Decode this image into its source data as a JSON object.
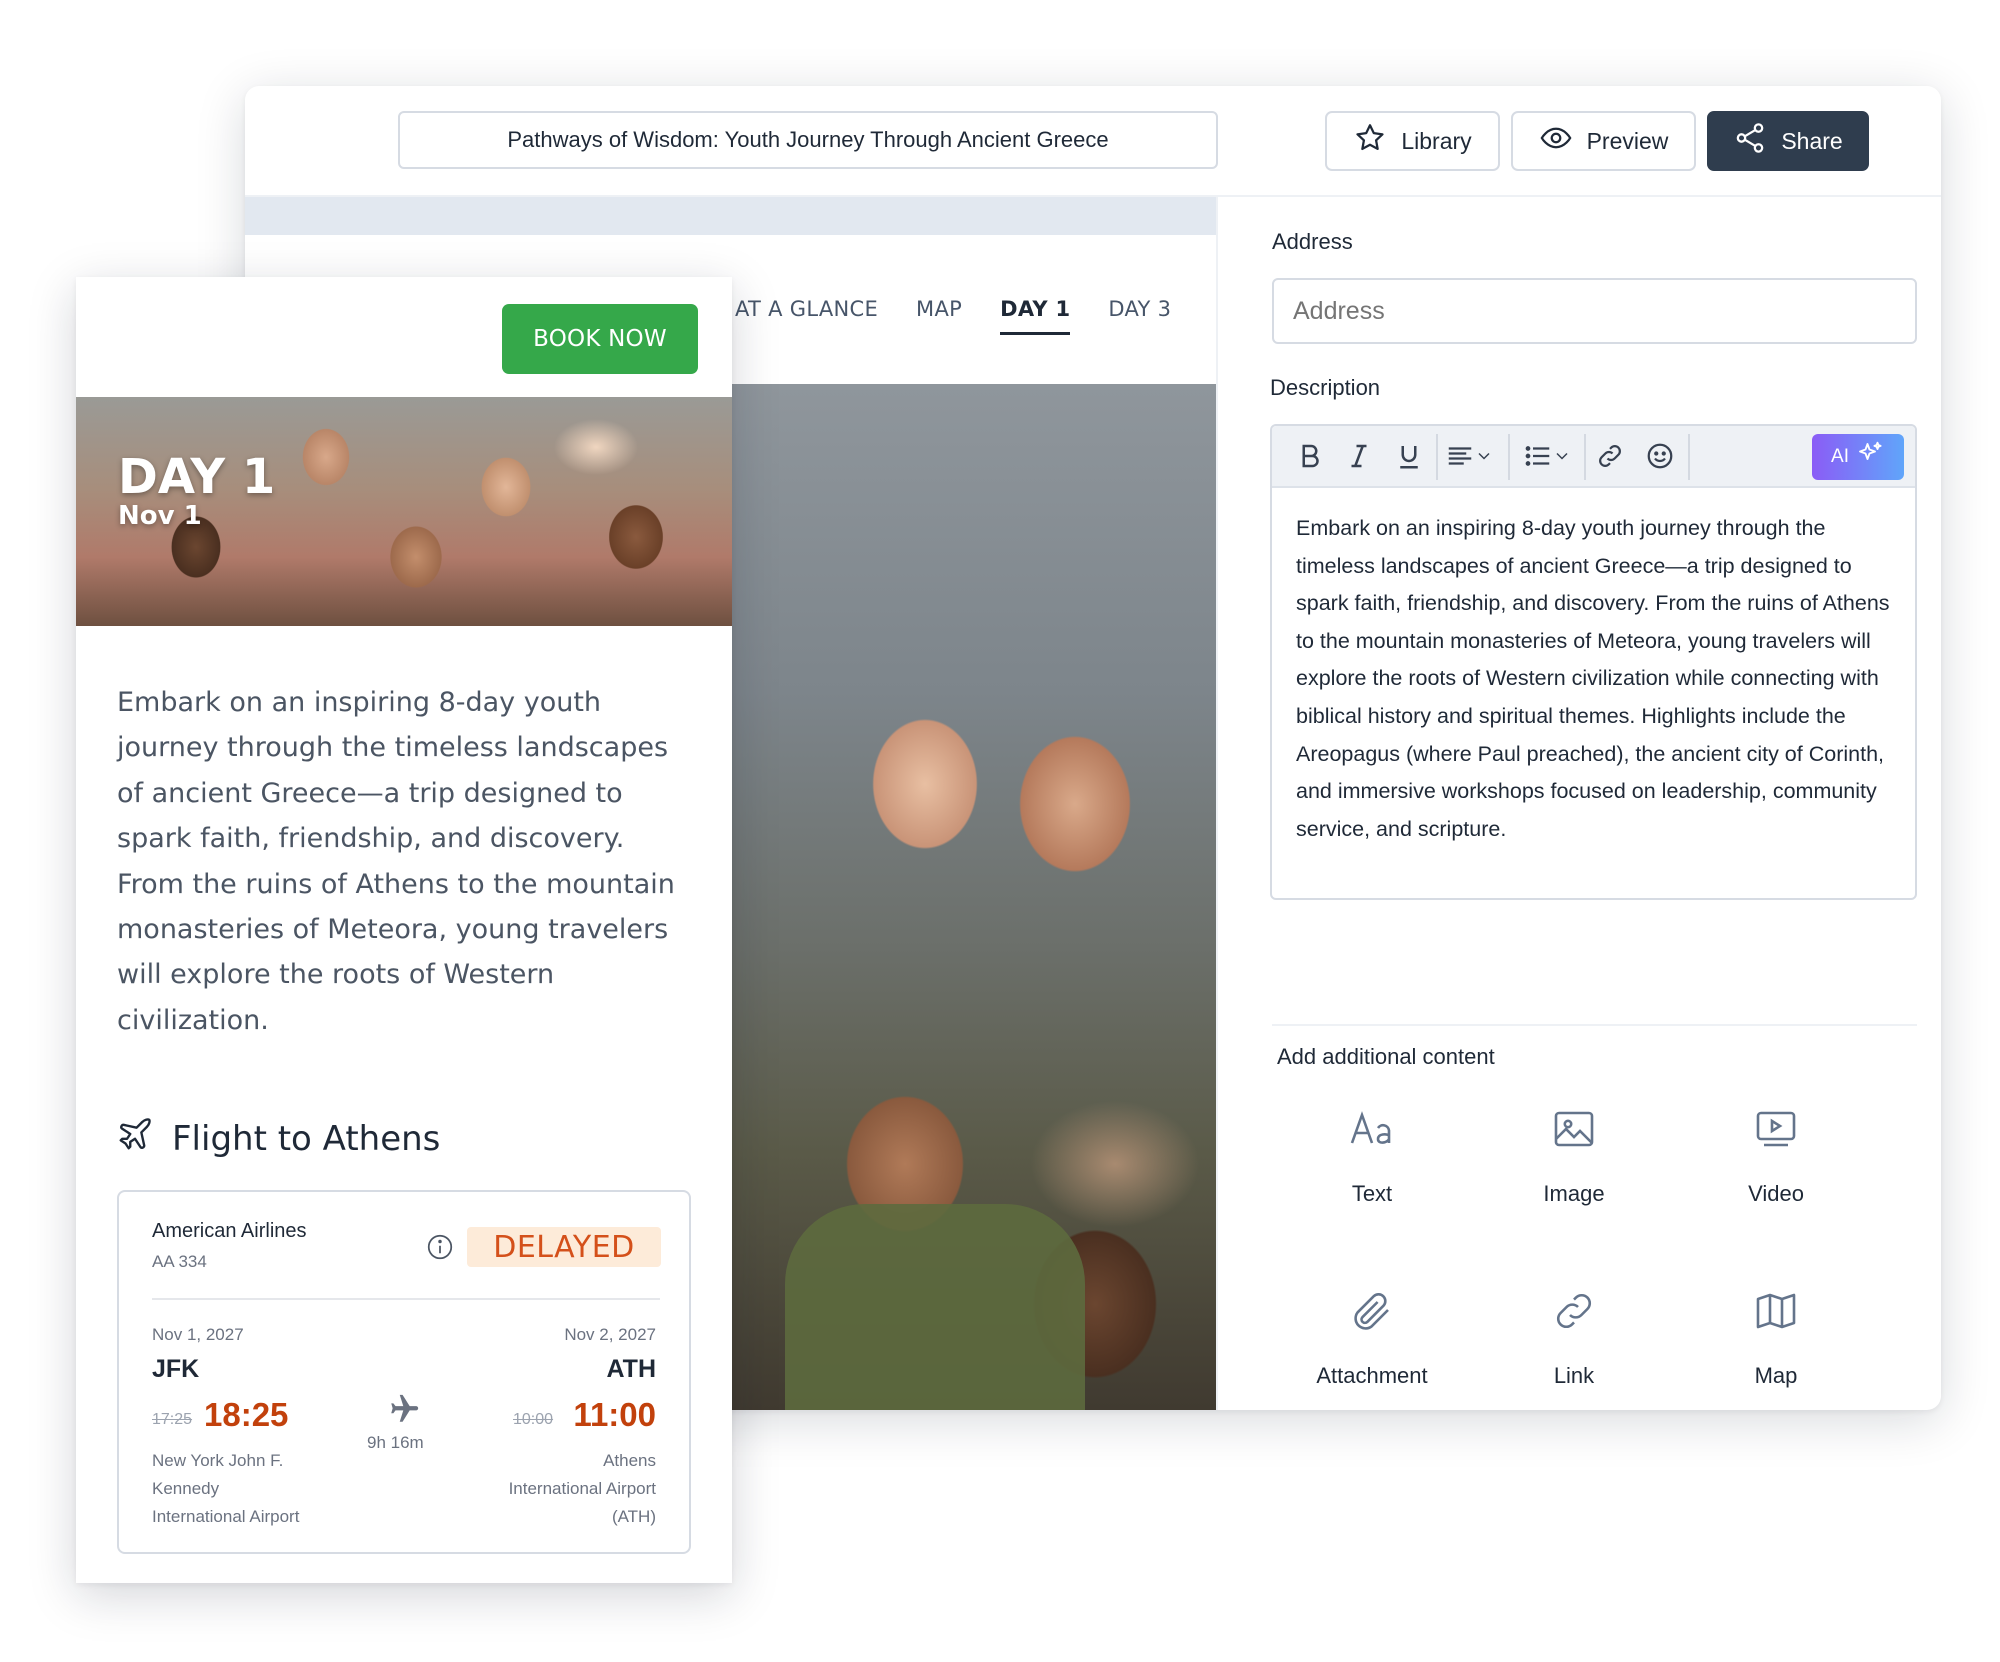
{
  "header": {
    "trip_title": "Pathways of Wisdom: Youth Journey Through Ancient Greece",
    "library_label": "Library",
    "preview_label": "Preview",
    "share_label": "Share"
  },
  "tabs": [
    {
      "label": "AT A GLANCE",
      "active": false
    },
    {
      "label": "MAP",
      "active": false
    },
    {
      "label": "DAY 1",
      "active": true
    },
    {
      "label": "DAY 3",
      "active": false
    }
  ],
  "side_panel": {
    "address_label": "Address",
    "address_placeholder": "Address",
    "description_label": "Description",
    "ai_label": "AI",
    "description_text": "Embark on an inspiring 8-day youth journey through the timeless landscapes of ancient Greece—a trip designed to spark faith, friendship, and discovery. From the ruins of Athens to the mountain monasteries of Meteora, young travelers will explore the roots of Western civilization while connecting with biblical history and spiritual themes. Highlights include the Areopagus (where Paul preached), the ancient city of Corinth, and immersive workshops focused on leadership, community service, and scripture.",
    "add_content_label": "Add additional content",
    "content_types": [
      {
        "label": "Text",
        "icon": "text-icon"
      },
      {
        "label": "Image",
        "icon": "image-icon"
      },
      {
        "label": "Video",
        "icon": "video-icon"
      },
      {
        "label": "Attachment",
        "icon": "paperclip-icon"
      },
      {
        "label": "Link",
        "icon": "link-icon"
      },
      {
        "label": "Map",
        "icon": "map-icon"
      }
    ]
  },
  "mobile": {
    "book_label": "BOOK NOW",
    "day_title": "DAY 1",
    "day_date": "Nov 1",
    "description": "Embark on an inspiring 8-day youth journey through the timeless landscapes of ancient Greece—a trip designed to spark faith, friendship, and discovery. From the ruins of Athens to the mountain monasteries of Meteora, young travelers will explore the roots of Western civilization.",
    "flight_heading": "Flight to Athens",
    "flight": {
      "airline": "American Airlines",
      "number": "AA 334",
      "status": "DELAYED",
      "status_color": "#d4501a",
      "duration": "9h 16m",
      "departure": {
        "date": "Nov 1, 2027",
        "code": "JFK",
        "old_time": "17:25",
        "time": "18:25",
        "airport_lines": [
          "New York John F.",
          "Kennedy",
          "International Airport"
        ]
      },
      "arrival": {
        "date": "Nov 2, 2027",
        "code": "ATH",
        "old_time": "10:00",
        "time": "11:00",
        "airport_lines": [
          "Athens",
          "International Airport",
          "(ATH)"
        ]
      }
    }
  },
  "colors": {
    "share_button": "#2f3d4e",
    "book_button": "#35a84a",
    "delayed_time": "#c2410c"
  }
}
